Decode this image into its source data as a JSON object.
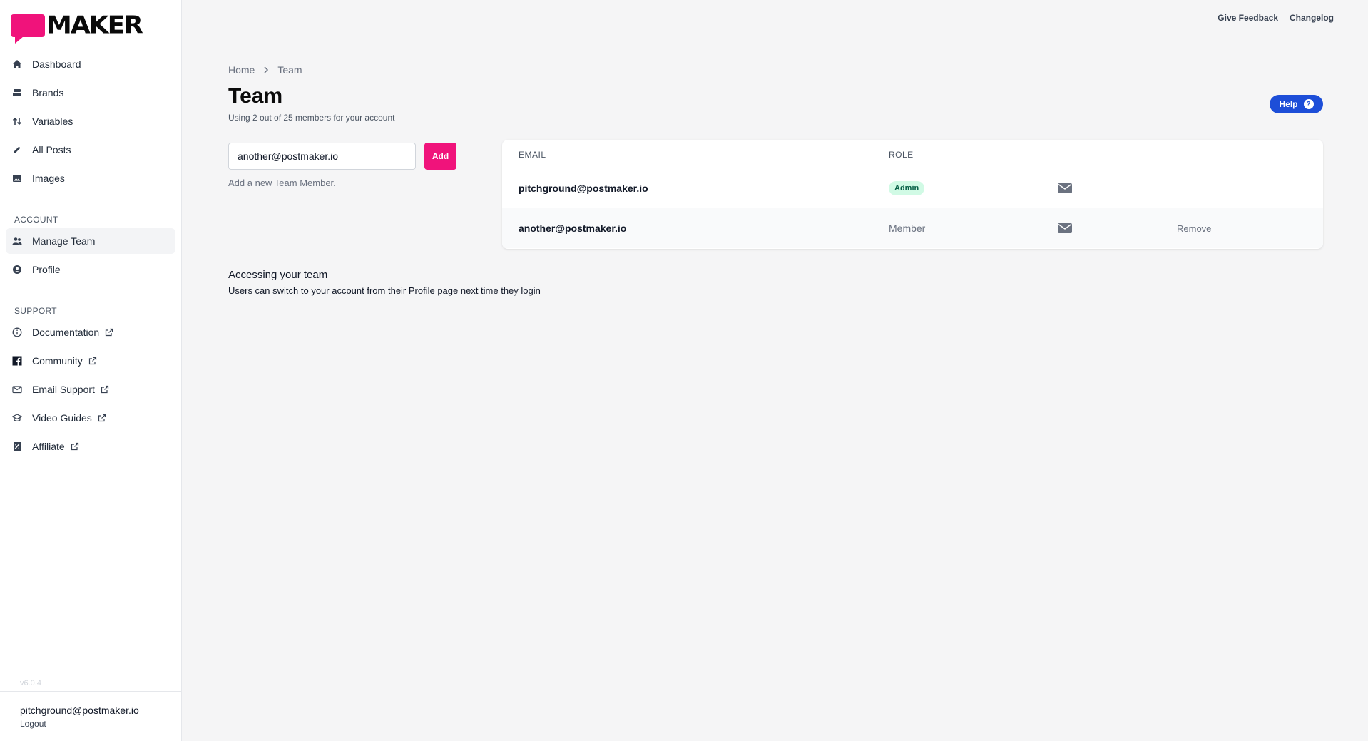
{
  "app": {
    "logo_text": "MAKER",
    "brand_color": "#f0137b"
  },
  "top_links": {
    "feedback": "Give Feedback",
    "changelog": "Changelog"
  },
  "sidebar": {
    "nav": [
      {
        "label": "Dashboard",
        "icon": "home-icon"
      },
      {
        "label": "Brands",
        "icon": "layers-icon"
      },
      {
        "label": "Variables",
        "icon": "swap-arrows-icon"
      },
      {
        "label": "All Posts",
        "icon": "pencil-icon"
      },
      {
        "label": "Images",
        "icon": "image-icon"
      }
    ],
    "account_label": "ACCOUNT",
    "account": [
      {
        "label": "Manage Team",
        "icon": "users-icon",
        "active": true
      },
      {
        "label": "Profile",
        "icon": "user-circle-icon"
      }
    ],
    "support_label": "SUPPORT",
    "support": [
      {
        "label": "Documentation",
        "icon": "info-icon"
      },
      {
        "label": "Community",
        "icon": "facebook-icon"
      },
      {
        "label": "Email Support",
        "icon": "envelope-icon"
      },
      {
        "label": "Video Guides",
        "icon": "graduation-cap-icon"
      },
      {
        "label": "Affiliate",
        "icon": "receipt-icon"
      }
    ],
    "version": "v6.0.4",
    "user_email": "pitchground@postmaker.io",
    "logout": "Logout"
  },
  "main": {
    "breadcrumb": [
      "Home",
      "Team"
    ],
    "title": "Team",
    "subtitle": "Using 2 out of 25 members for your account",
    "help_label": "Help",
    "help_icon": "?",
    "add_form": {
      "value": "another@postmaker.io",
      "button": "Add",
      "hint": "Add a new Team Member."
    },
    "table": {
      "headers": {
        "email": "EMAIL",
        "role": "ROLE"
      },
      "rows": [
        {
          "email": "pitchground@postmaker.io",
          "role": "Admin",
          "action": ""
        },
        {
          "email": "another@postmaker.io",
          "role": "Member",
          "action": "Remove"
        }
      ]
    },
    "info": {
      "title": "Accessing your team",
      "text": "Users can switch to your account from their Profile page next time they login"
    }
  }
}
